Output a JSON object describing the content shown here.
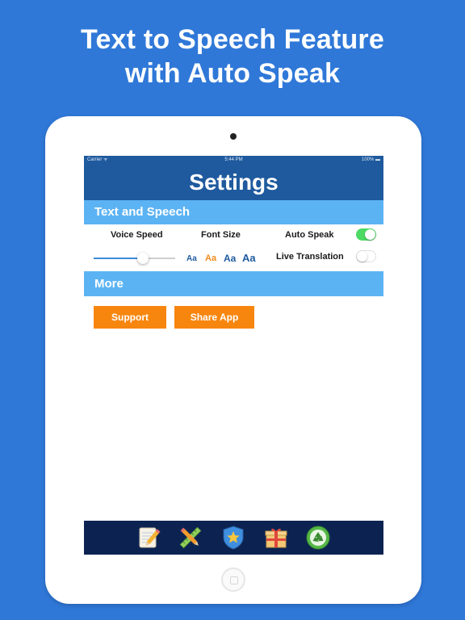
{
  "headline": {
    "line1": "Text to Speech Feature",
    "line2": "with Auto Speak"
  },
  "status_bar": {
    "carrier": "Carrier ᯤ",
    "time": "5:44 PM",
    "battery": "100% ▬"
  },
  "nav": {
    "title": "Settings"
  },
  "sections": {
    "text_speech": "Text and Speech",
    "more": "More"
  },
  "text_speech": {
    "voice_speed_label": "Voice Speed",
    "voice_speed_value": 0.6,
    "font_size_label": "Font Size",
    "font_size_options": [
      "Aa",
      "Aa",
      "Aa",
      "Aa"
    ],
    "font_size_selected_index": 1,
    "auto_speak_label": "Auto Speak",
    "auto_speak_on": true,
    "live_translation_label": "Live Translation",
    "live_translation_on": false
  },
  "more": {
    "support_label": "Support",
    "share_label": "Share App"
  },
  "tabbar": {
    "tabs": [
      "notepad-pencil-icon",
      "pencil-ruler-icon",
      "star-shield-icon",
      "gift-box-icon",
      "recycle-icon"
    ]
  },
  "colors": {
    "background": "#2f78d8",
    "navbar": "#1f5a9e",
    "section_header": "#5cb3f4",
    "accent_orange": "#f7860f",
    "toggle_on": "#4cd964",
    "tabbar": "#0c2352"
  }
}
